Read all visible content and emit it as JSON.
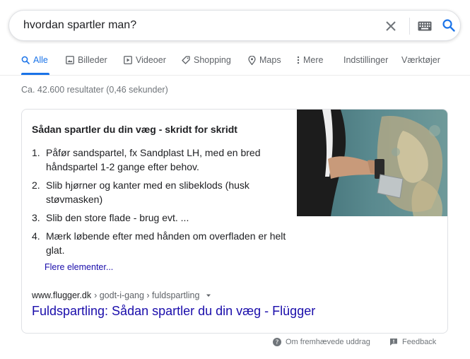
{
  "search": {
    "query": "hvordan spartler man?"
  },
  "tabs": [
    {
      "label": "Alle",
      "icon": "search-icon",
      "active": true
    },
    {
      "label": "Billeder",
      "icon": "image-icon"
    },
    {
      "label": "Videoer",
      "icon": "video-icon"
    },
    {
      "label": "Shopping",
      "icon": "tag-icon"
    },
    {
      "label": "Maps",
      "icon": "map-pin-icon"
    },
    {
      "label": "Mere",
      "icon": "more-vert-icon"
    },
    {
      "label": "Indstillinger"
    },
    {
      "label": "Værktøjer"
    }
  ],
  "results_info": "Ca. 42.600 resultater (0,46 sekunder)",
  "snippet": {
    "title": "Sådan spartler du din væg - skridt for skridt",
    "steps": [
      {
        "num": "1.",
        "text": "Påfør sandspartel, fx Sandplast LH, med en bred håndspartel 1-2 gange efter behov."
      },
      {
        "num": "2.",
        "text": "Slib hjørner og kanter med en slibeklods (husk støvmasken)"
      },
      {
        "num": "3.",
        "text": "Slib den store flade - brug evt. ..."
      },
      {
        "num": "4.",
        "text": "Mærk løbende efter med hånden om overfladen er helt glat."
      }
    ],
    "more_label": "Flere elementer...",
    "site": "www.flugger.dk",
    "path": " › godt-i-gang › fuldspartling",
    "link_title": "Fuldspartling: Sådan spartler du din væg - Flügger"
  },
  "footer": {
    "about_label": "Om fremhævede uddrag",
    "feedback_label": "Feedback"
  },
  "colors": {
    "accent": "#1a73e8",
    "link": "#1a0dab",
    "wall": "#4f7e84",
    "shirt": "#1c1c1c"
  }
}
